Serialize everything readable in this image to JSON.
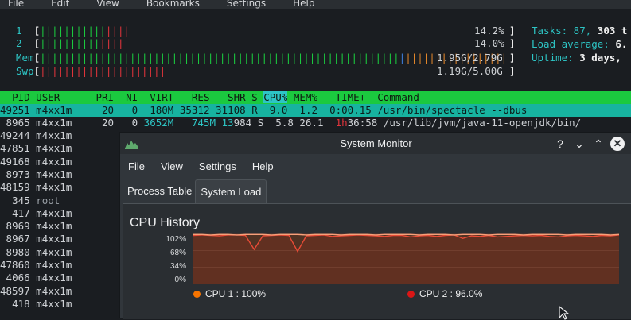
{
  "terminal": {
    "menu": [
      "File",
      "Edit",
      "View",
      "Bookmarks",
      "Settings",
      "Help"
    ],
    "cpu_meters": [
      {
        "label": "1",
        "percent": "14.2%",
        "green_bars": 11,
        "red_bars": 4
      },
      {
        "label": "2",
        "percent": "14.0%",
        "green_bars": 10,
        "red_bars": 4
      }
    ],
    "mem_meter": {
      "label": "Mem",
      "value": "1.95G/2.79G"
    },
    "swp_meter": {
      "label": "Swp",
      "value": "1.19G/5.00G"
    },
    "summary": {
      "tasks_label": "Tasks: 87, ",
      "tasks_threads": "303 t",
      "load_label": "Load average: ",
      "load_value": "6.",
      "uptime_label": "Uptime: ",
      "uptime_value": "3 days,"
    },
    "columns": [
      "PID",
      "USER",
      "PRI",
      "NI",
      "VIRT",
      "RES",
      "SHR",
      "S",
      "CPU%",
      "MEM%",
      "TIME+",
      "Command"
    ],
    "selected_row": {
      "pid": "49251",
      "user": "m4xx1m",
      "pri": "20",
      "ni": "0",
      "virt": "180M",
      "res": "35312",
      "shr": "31108",
      "s": "R",
      "cpu": "9.0",
      "mem": "1.2",
      "time": "0:00.15",
      "command": "/usr/bin/spectacle --dbus"
    },
    "second_row": {
      "pid": "8965",
      "user": "m4xx1m",
      "pri": "20",
      "ni": "0",
      "virt_a": "3652M",
      "res_a": "745M",
      "shr_a": "13",
      "shr_b": "984",
      "s": "S",
      "cpu": "5.8",
      "mem": "26.1",
      "time_a": "1h",
      "time_b": "36:58",
      "command": "/usr/lib/jvm/java-11-openjdk/bin/"
    },
    "other_rows": [
      {
        "pid": "49244",
        "user": "m4xx1m"
      },
      {
        "pid": "47851",
        "user": "m4xx1m"
      },
      {
        "pid": "49168",
        "user": "m4xx1m"
      },
      {
        "pid": "8973",
        "user": "m4xx1m"
      },
      {
        "pid": "48159",
        "user": "m4xx1m"
      },
      {
        "pid": "345",
        "user": "root"
      },
      {
        "pid": "417",
        "user": "m4xx1m"
      },
      {
        "pid": "8969",
        "user": "m4xx1m"
      },
      {
        "pid": "8967",
        "user": "m4xx1m"
      },
      {
        "pid": "8980",
        "user": "m4xx1m"
      },
      {
        "pid": "47860",
        "user": "m4xx1m"
      },
      {
        "pid": "4066",
        "user": "m4xx1m"
      },
      {
        "pid": "48597",
        "user": "m4xx1m"
      },
      {
        "pid": "418",
        "user": "m4xx1m"
      }
    ]
  },
  "sysmon": {
    "title": "System Monitor",
    "buttons": {
      "help": "?",
      "minimize": "⌄",
      "maximize": "⌃",
      "close": "✕"
    },
    "menu": [
      "File",
      "View",
      "Settings",
      "Help"
    ],
    "tabs": [
      {
        "label": "Process Table",
        "active": false
      },
      {
        "label": "System Load",
        "active": true
      }
    ],
    "panel_title": "CPU History",
    "y_ticks": [
      "102%",
      "68%",
      "34%",
      "0%"
    ],
    "legend": [
      {
        "label": "CPU 1 : 100%",
        "color": "#f67400"
      },
      {
        "label": "CPU 2 : 96.0%",
        "color": "#da1616"
      }
    ]
  },
  "chart_data": {
    "type": "area",
    "ylim": [
      0,
      102
    ],
    "y_ticks": [
      "102%",
      "68%",
      "34%",
      "0%"
    ],
    "series": [
      {
        "name": "CPU 1",
        "color": "#f67400",
        "values": [
          100,
          100,
          99,
          100,
          100,
          99,
          100,
          100,
          100,
          99,
          100,
          100,
          100,
          99,
          100,
          100,
          100,
          99,
          100,
          100,
          100,
          99,
          100,
          100,
          100,
          100,
          99,
          100,
          100,
          100,
          99,
          100,
          100,
          100,
          99,
          100,
          100,
          100,
          99,
          100,
          100,
          100,
          100,
          99,
          100,
          100,
          100,
          100,
          99,
          100
        ]
      },
      {
        "name": "CPU 2",
        "color": "#da1616",
        "values": [
          98,
          99,
          98,
          97,
          99,
          99,
          98,
          70,
          97,
          98,
          99,
          98,
          66,
          97,
          98,
          99,
          96,
          97,
          98,
          99,
          98,
          97,
          96,
          98,
          98,
          95,
          97,
          98,
          96,
          98,
          99,
          92,
          97,
          96,
          98,
          95,
          96,
          97,
          98,
          97,
          98,
          96,
          95,
          97,
          98,
          97,
          96,
          98,
          97,
          99
        ]
      }
    ]
  }
}
